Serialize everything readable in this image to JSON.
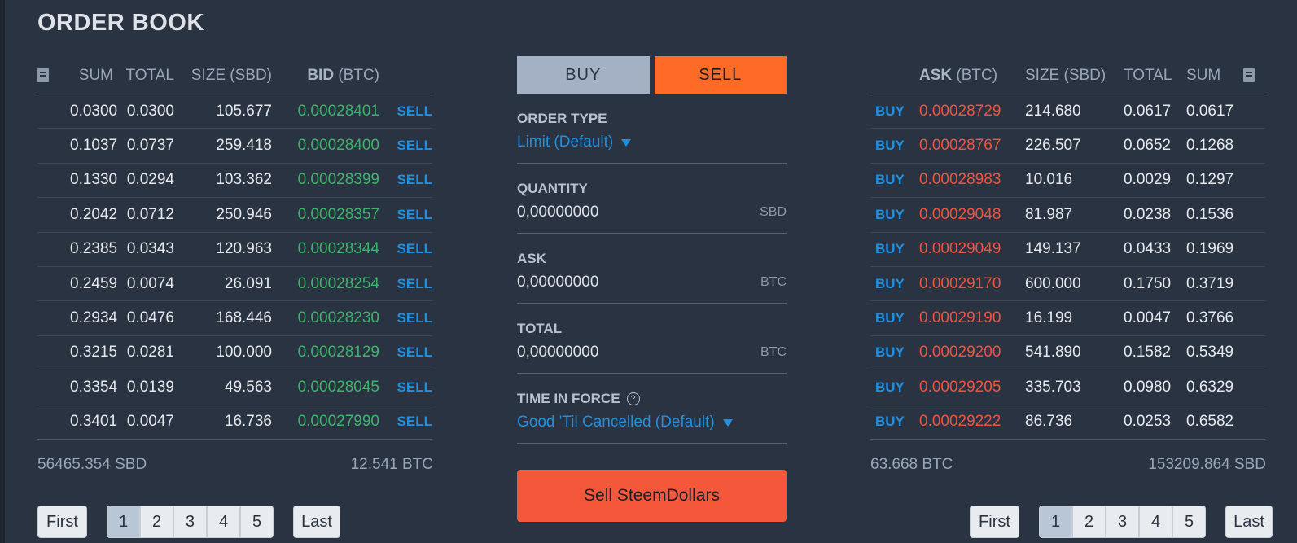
{
  "title": "ORDER BOOK",
  "bids": {
    "headers": {
      "sum": "SUM",
      "total": "TOTAL",
      "size": "SIZE (SBD)",
      "bid": "BID",
      "bid_unit": "(BTC)"
    },
    "rows": [
      {
        "sum": "0.0300",
        "total": "0.0300",
        "size": "105.677",
        "price": "0.00028401",
        "action": "SELL"
      },
      {
        "sum": "0.1037",
        "total": "0.0737",
        "size": "259.418",
        "price": "0.00028400",
        "action": "SELL"
      },
      {
        "sum": "0.1330",
        "total": "0.0294",
        "size": "103.362",
        "price": "0.00028399",
        "action": "SELL"
      },
      {
        "sum": "0.2042",
        "total": "0.0712",
        "size": "250.946",
        "price": "0.00028357",
        "action": "SELL"
      },
      {
        "sum": "0.2385",
        "total": "0.0343",
        "size": "120.963",
        "price": "0.00028344",
        "action": "SELL"
      },
      {
        "sum": "0.2459",
        "total": "0.0074",
        "size": "26.091",
        "price": "0.00028254",
        "action": "SELL"
      },
      {
        "sum": "0.2934",
        "total": "0.0476",
        "size": "168.446",
        "price": "0.00028230",
        "action": "SELL"
      },
      {
        "sum": "0.3215",
        "total": "0.0281",
        "size": "100.000",
        "price": "0.00028129",
        "action": "SELL"
      },
      {
        "sum": "0.3354",
        "total": "0.0139",
        "size": "49.563",
        "price": "0.00028045",
        "action": "SELL"
      },
      {
        "sum": "0.3401",
        "total": "0.0047",
        "size": "16.736",
        "price": "0.00027990",
        "action": "SELL"
      }
    ],
    "total_sbd": "56465.354 SBD",
    "total_btc": "12.541 BTC"
  },
  "asks": {
    "headers": {
      "ask": "ASK",
      "ask_unit": "(BTC)",
      "size": "SIZE (SBD)",
      "total": "TOTAL",
      "sum": "SUM"
    },
    "rows": [
      {
        "action": "BUY",
        "price": "0.00028729",
        "size": "214.680",
        "total": "0.0617",
        "sum": "0.0617"
      },
      {
        "action": "BUY",
        "price": "0.00028767",
        "size": "226.507",
        "total": "0.0652",
        "sum": "0.1268"
      },
      {
        "action": "BUY",
        "price": "0.00028983",
        "size": "10.016",
        "total": "0.0029",
        "sum": "0.1297"
      },
      {
        "action": "BUY",
        "price": "0.00029048",
        "size": "81.987",
        "total": "0.0238",
        "sum": "0.1536"
      },
      {
        "action": "BUY",
        "price": "0.00029049",
        "size": "149.137",
        "total": "0.0433",
        "sum": "0.1969"
      },
      {
        "action": "BUY",
        "price": "0.00029170",
        "size": "600.000",
        "total": "0.1750",
        "sum": "0.3719"
      },
      {
        "action": "BUY",
        "price": "0.00029190",
        "size": "16.199",
        "total": "0.0047",
        "sum": "0.3766"
      },
      {
        "action": "BUY",
        "price": "0.00029200",
        "size": "541.890",
        "total": "0.1582",
        "sum": "0.5349"
      },
      {
        "action": "BUY",
        "price": "0.00029205",
        "size": "335.703",
        "total": "0.0980",
        "sum": "0.6329"
      },
      {
        "action": "BUY",
        "price": "0.00029222",
        "size": "86.736",
        "total": "0.0253",
        "sum": "0.6582"
      }
    ],
    "total_btc": "63.668 BTC",
    "total_sbd": "153209.864 SBD"
  },
  "form": {
    "buy_label": "BUY",
    "sell_label": "SELL",
    "order_type_label": "ORDER TYPE",
    "order_type_value": "Limit (Default)",
    "quantity_label": "QUANTITY",
    "quantity_value": "0,00000000",
    "quantity_unit": "SBD",
    "ask_label": "ASK",
    "ask_value": "0,00000000",
    "ask_unit": "BTC",
    "total_label": "TOTAL",
    "total_value": "0,00000000",
    "total_unit": "BTC",
    "tif_label": "TIME IN FORCE",
    "tif_help": "?",
    "tif_value": "Good 'Til Cancelled (Default)",
    "submit_label": "Sell SteemDollars"
  },
  "pager": {
    "first": "First",
    "last": "Last",
    "pages": [
      "1",
      "2",
      "3",
      "4",
      "5"
    ],
    "active": "1"
  },
  "colors": {
    "bid": "#3ab56a",
    "ask": "#f1533f",
    "link": "#1f8fe0",
    "sell_accent": "#ff6a26"
  }
}
